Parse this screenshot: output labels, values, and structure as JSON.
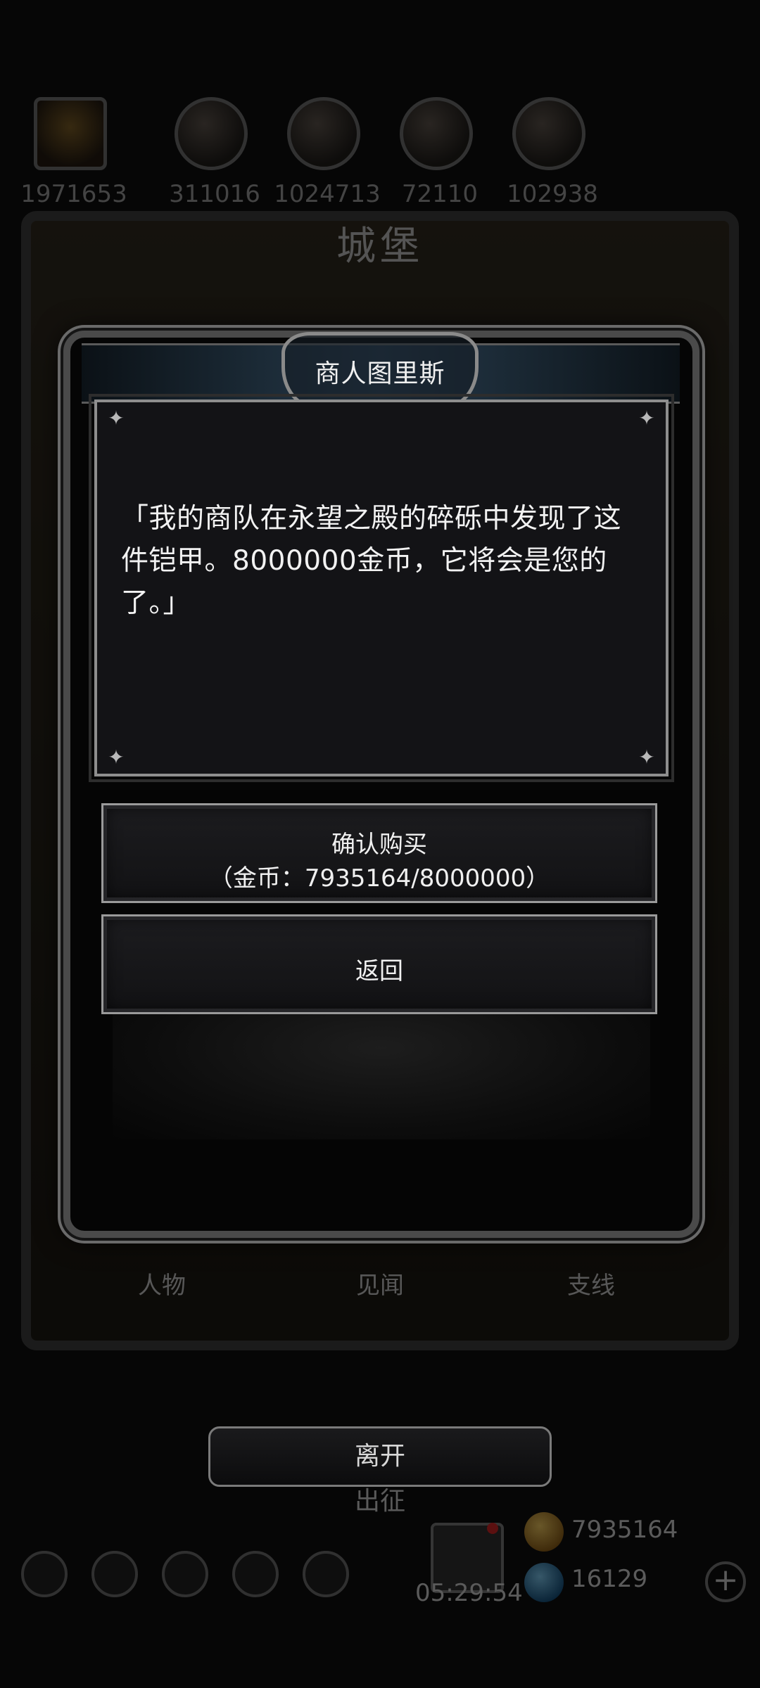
{
  "background": {
    "resources": [
      {
        "icon": "hero-portrait-icon",
        "value": "1971653"
      },
      {
        "icon": "ore-resource-icon",
        "value": "311016"
      },
      {
        "icon": "wood-resource-icon",
        "value": "1024713"
      },
      {
        "icon": "iron-resource-icon",
        "value": "72110"
      },
      {
        "icon": "crystal-resource-icon",
        "value": "102938"
      }
    ],
    "castle_title": "城堡",
    "tabs": [
      "人物",
      "见闻",
      "支线"
    ],
    "expedition_label": "出征",
    "timer": "05:29:54",
    "gold": "7935164",
    "gems": "16129",
    "add_symbol": "+"
  },
  "dialog": {
    "title": "商人图里斯",
    "message": "「我的商队在永望之殿的碎砾中发现了这件铠甲。8000000金币，它将会是您的了。」",
    "confirm": {
      "label": "确认购买",
      "cost_line": "（金币：7935164/8000000）"
    },
    "back_label": "返回"
  },
  "leave_label": "离开",
  "colors": {
    "dialog_bg": "#050505",
    "message_bg": "#131316",
    "frame_gray": "#8e8e8e",
    "header_blue": "#26384a"
  }
}
